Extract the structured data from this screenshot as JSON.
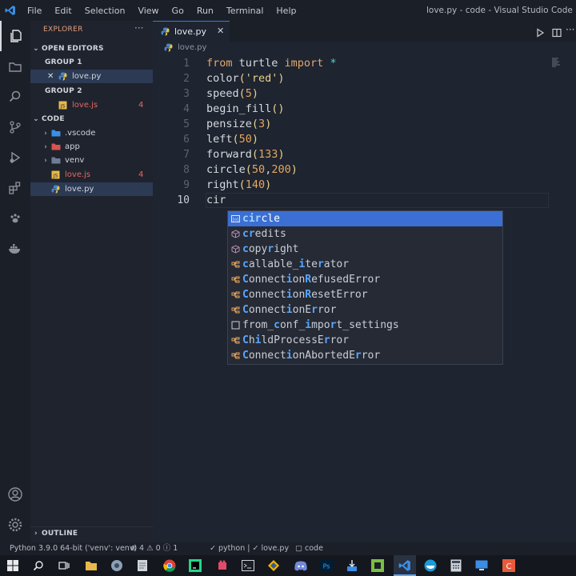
{
  "titlebar": {
    "menu": [
      "File",
      "Edit",
      "Selection",
      "View",
      "Go",
      "Run",
      "Terminal",
      "Help"
    ],
    "window_title": "love.py - code - Visual Studio Code [Admini"
  },
  "sidebar": {
    "title": "EXPLORER",
    "more": "···",
    "open_editors": "OPEN EDITORS",
    "group1": "GROUP 1",
    "group1_file": "love.py",
    "group2": "GROUP 2",
    "group2_file": "love.js",
    "group2_badge": "4",
    "folder": "CODE",
    "items": [
      {
        "label": ".vscode",
        "kind": "folder"
      },
      {
        "label": "app",
        "kind": "folder"
      },
      {
        "label": "venv",
        "kind": "folder"
      },
      {
        "label": "love.js",
        "kind": "js",
        "badge": "4"
      },
      {
        "label": "love.py",
        "kind": "py"
      }
    ],
    "outline": "OUTLINE"
  },
  "editor": {
    "tab_label": "love.py",
    "tab_close": "✕",
    "breadcrumb": "love.py",
    "more": "···",
    "line_numbers": [
      "1",
      "2",
      "3",
      "4",
      "5",
      "6",
      "7",
      "8",
      "9",
      "10"
    ]
  },
  "suggest": {
    "items": [
      {
        "pre": "",
        "hl1": "cir",
        "rest": "cle",
        "icon": "var-icon"
      },
      {
        "pre": "",
        "hl1": "c",
        "mid": "",
        "hl2": "r",
        "rest": "edits",
        "icon": "cube-icon"
      },
      {
        "pre": "",
        "hl1": "c",
        "mid": "opy",
        "hl2": "r",
        "rest": "ight",
        "icon": "cube-icon"
      },
      {
        "pre": "",
        "hl1": "c",
        "mid": "allable_",
        "hl2": "i",
        "mid2": "te",
        "hl3": "r",
        "rest": "ator",
        "icon": "class-icon"
      },
      {
        "pre": "",
        "hl1": "C",
        "mid": "onnect",
        "hl2": "i",
        "mid2": "on",
        "hl3": "R",
        "rest": "efusedError",
        "icon": "class-icon"
      },
      {
        "pre": "",
        "hl1": "C",
        "mid": "onnect",
        "hl2": "i",
        "mid2": "on",
        "hl3": "R",
        "rest": "esetError",
        "icon": "class-icon"
      },
      {
        "pre": "",
        "hl1": "C",
        "mid": "onnect",
        "hl2": "i",
        "mid2": "onE",
        "hl3": "r",
        "rest": "ror",
        "icon": "class-icon"
      },
      {
        "pre": "from_",
        "hl1": "c",
        "mid": "onf_",
        "hl2": "i",
        "mid2": "mpo",
        "hl3": "r",
        "rest": "t_settings",
        "icon": "square-icon"
      },
      {
        "pre": "",
        "hl1": "C",
        "mid": "h",
        "hl2": "i",
        "mid2": "ldProcessE",
        "hl3": "r",
        "rest": "ror",
        "icon": "class-icon"
      },
      {
        "pre": "",
        "hl1": "C",
        "mid": "onnect",
        "hl2": "i",
        "mid2": "onAbortedE",
        "hl3": "r",
        "rest": "ror",
        "icon": "class-icon"
      }
    ]
  },
  "statusbar": {
    "python": "Python 3.9.0 64-bit ('venv': venv)",
    "errors": "4",
    "warnings": "0",
    "info": "1",
    "lang": "python |",
    "file": "love.py",
    "folder": "code"
  },
  "colors": {
    "accent": "#3b6fd3",
    "error_red": "#e36a63",
    "keyword": "#e0a96d"
  }
}
